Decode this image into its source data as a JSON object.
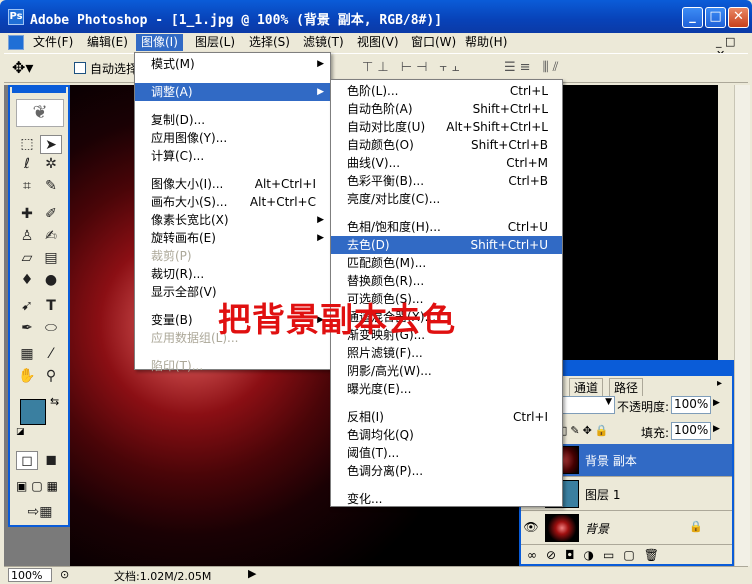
{
  "window": {
    "title": "Adobe Photoshop - [1_1.jpg @ 100% (背景 副本, RGB/8#)]"
  },
  "menubar": [
    "文件(F)",
    "编辑(E)",
    "图像(I)",
    "图层(L)",
    "选择(S)",
    "滤镜(T)",
    "视图(V)",
    "窗口(W)",
    "帮助(H)"
  ],
  "options": {
    "auto_select": "自动选择"
  },
  "image_menu": [
    {
      "label": "模式(M)",
      "arrow": true
    },
    {
      "sep": true
    },
    {
      "label": "调整(A)",
      "arrow": true,
      "hl": true
    },
    {
      "sep": true
    },
    {
      "label": "复制(D)..."
    },
    {
      "label": "应用图像(Y)..."
    },
    {
      "label": "计算(C)..."
    },
    {
      "sep": true
    },
    {
      "label": "图像大小(I)...",
      "sc": "Alt+Ctrl+I"
    },
    {
      "label": "画布大小(S)...",
      "sc": "Alt+Ctrl+C"
    },
    {
      "label": "像素长宽比(X)",
      "arrow": true
    },
    {
      "label": "旋转画布(E)",
      "arrow": true
    },
    {
      "label": "裁剪(P)",
      "dis": true
    },
    {
      "label": "裁切(R)..."
    },
    {
      "label": "显示全部(V)"
    },
    {
      "sep": true
    },
    {
      "label": "变量(B)",
      "arrow": true
    },
    {
      "label": "应用数据组(L)...",
      "dis": true
    },
    {
      "sep": true
    },
    {
      "label": "陷印(T)...",
      "dis": true
    }
  ],
  "adjust_menu": [
    {
      "label": "色阶(L)...",
      "sc": "Ctrl+L"
    },
    {
      "label": "自动色阶(A)",
      "sc": "Shift+Ctrl+L"
    },
    {
      "label": "自动对比度(U)",
      "sc": "Alt+Shift+Ctrl+L"
    },
    {
      "label": "自动颜色(O)",
      "sc": "Shift+Ctrl+B"
    },
    {
      "label": "曲线(V)...",
      "sc": "Ctrl+M"
    },
    {
      "label": "色彩平衡(B)...",
      "sc": "Ctrl+B"
    },
    {
      "label": "亮度/对比度(C)..."
    },
    {
      "sep": true
    },
    {
      "label": "色相/饱和度(H)...",
      "sc": "Ctrl+U"
    },
    {
      "label": "去色(D)",
      "sc": "Shift+Ctrl+U",
      "hl": true
    },
    {
      "label": "匹配颜色(M)..."
    },
    {
      "label": "替换颜色(R)..."
    },
    {
      "label": "可选颜色(S)..."
    },
    {
      "label": "通道混合器(X)..."
    },
    {
      "label": "渐变映射(G)..."
    },
    {
      "label": "照片滤镜(F)..."
    },
    {
      "label": "阴影/高光(W)..."
    },
    {
      "label": "曝光度(E)..."
    },
    {
      "sep": true
    },
    {
      "label": "反相(I)",
      "sc": "Ctrl+I"
    },
    {
      "label": "色调均化(Q)"
    },
    {
      "label": "阈值(T)..."
    },
    {
      "label": "色调分离(P)..."
    },
    {
      "sep": true
    },
    {
      "label": "变化..."
    }
  ],
  "annotation": "把背景副本去色",
  "layers_panel": {
    "tabs": [
      "通道",
      "路径"
    ],
    "opacity_label": "不透明度:",
    "opacity": "100%",
    "fill_label": "填充:",
    "fill": "100%",
    "layers": [
      {
        "name": "背景 副本",
        "selected": true
      },
      {
        "name": "图层 1"
      },
      {
        "name": "背景",
        "locked": true
      }
    ]
  },
  "status": {
    "zoom": "100%",
    "doc": "文档:1.02M/2.05M"
  },
  "colors": {
    "accent": "#316ac5",
    "title_blue": "#0a5cd8",
    "annotation": "#e01010"
  }
}
